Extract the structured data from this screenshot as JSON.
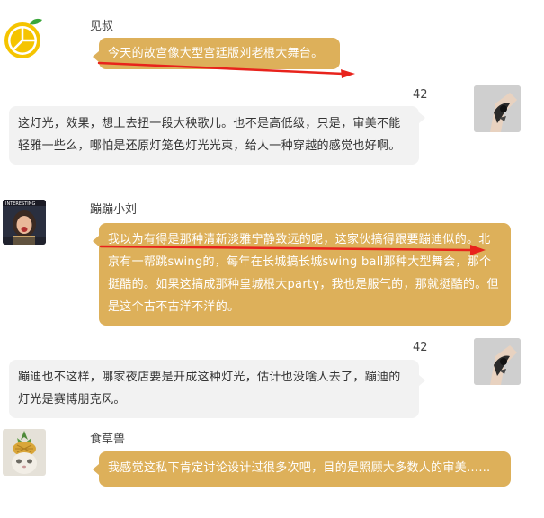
{
  "messages": [
    {
      "sender": "见叔",
      "avatar_icon": "orange-slice-logo-icon",
      "text": "今天的故宫像大型宫廷版刘老根大舞台。"
    },
    {
      "sender_badge": "42",
      "avatar_icon": "tattoo-arm-icon",
      "text": "这灯光，效果，想上去扭一段大秧歌儿。也不是高低级，只是，审美不能轻雅一些么，哪怕是还原灯笼色灯光光束，给人一种穿越的感觉也好啊。"
    },
    {
      "sender": "蹦蹦小刘",
      "avatar_icon": "interesting-girl-photo-icon",
      "avatar_caption": "INTERESTING",
      "text": "我以为有得是那种清新淡雅宁静致远的呢，这家伙搞得跟要蹦迪似的。北京有一帮跳swing的，每年在长城搞长城swing ball那种大型舞会，那个挺酷的。如果这搞成那种皇城根大party，我也是服气的，那就挺酷的。但是这个古不古洋不洋的。"
    },
    {
      "sender_badge": "42",
      "avatar_icon": "tattoo-arm-icon",
      "text": "蹦迪也不这样，哪家夜店要是开成这种灯光，估计也没啥人去了，蹦迪的灯光是赛博朋克风。"
    },
    {
      "sender": "食草兽",
      "avatar_icon": "pineapple-cat-photo-icon",
      "text": "我感觉这私下肯定讨论设计过很多次吧，目的是照顾大多数人的审美……"
    }
  ],
  "colors": {
    "orange_bubble": "#ddb05a",
    "gray_bubble": "#f2f2f2",
    "annotation_arrow": "#e8231c"
  }
}
